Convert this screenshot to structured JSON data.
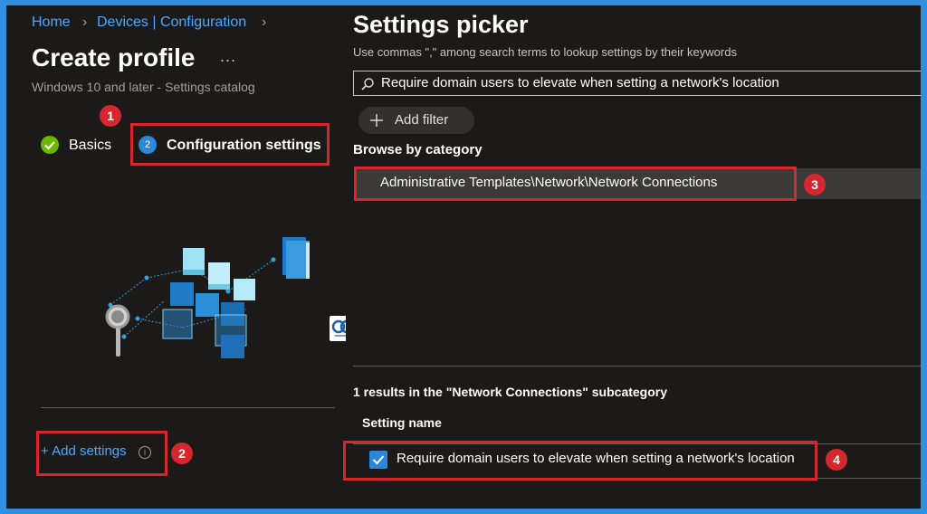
{
  "breadcrumb": [
    "Home",
    "Devices | Configuration"
  ],
  "page_title": "Create profile",
  "more_label": "...",
  "subtitle": "Windows 10 and later - Settings catalog",
  "steps": [
    {
      "label": "Basics",
      "state": "complete"
    },
    {
      "number": "2",
      "label": "Configuration settings",
      "state": "active"
    }
  ],
  "add_settings": "+ Add settings",
  "info_glyph": "i",
  "annotations": [
    "1",
    "2",
    "3",
    "4"
  ],
  "picker": {
    "title": "Settings picker",
    "subtitle": "Use commas \",\" among search terms to lookup settings by their keywords",
    "search_value": "Require domain users to elevate when setting a network's location",
    "add_filter": "Add filter",
    "browse_heading": "Browse by category",
    "category": "Administrative Templates\\Network\\Network Connections",
    "results_text": "1 results in the \"Network Connections\" subcategory",
    "column_header": "Setting name",
    "setting_item": "Require domain users to elevate when setting a network's location",
    "setting_checked": true
  },
  "colors": {
    "accent": "#2b88d8",
    "link": "#4aa8ff",
    "annotation": "#d6262e",
    "success": "#6bb700",
    "background": "#1b1a19",
    "outer_border": "#2f8fe0"
  },
  "icons": [
    "chevron-right-icon",
    "check-circle-icon",
    "search-icon",
    "plus-icon",
    "info-icon",
    "checkbox-checked-icon",
    "settings-catalog-illustration",
    "site-logo"
  ]
}
